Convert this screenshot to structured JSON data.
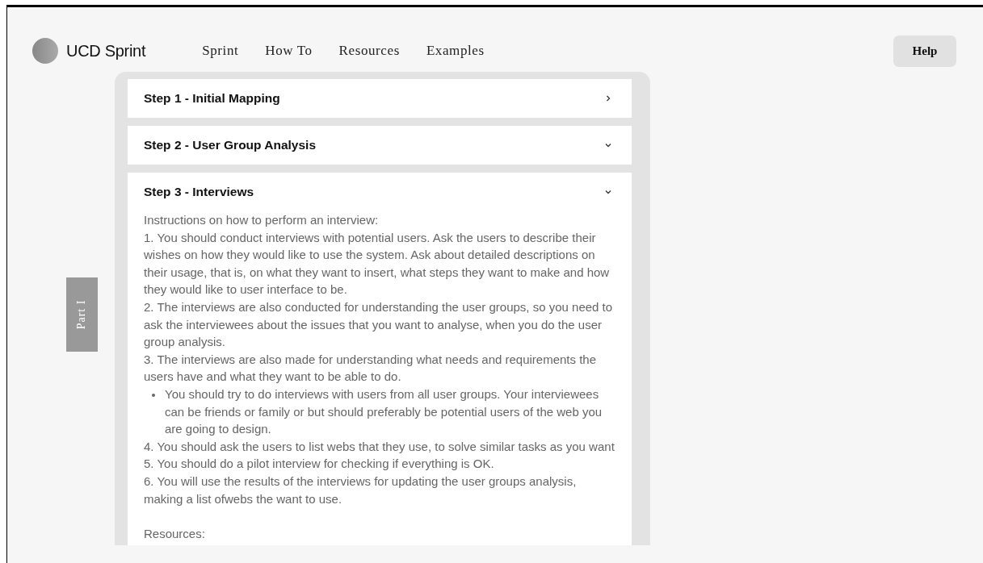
{
  "header": {
    "logo_text": "UCD Sprint",
    "nav": [
      "Sprint",
      "How To",
      "Resources",
      "Examples"
    ],
    "help_button": "Help"
  },
  "side_tab": "Part I",
  "steps": [
    {
      "title": "Step 1 - Initial Mapping",
      "expanded": false
    },
    {
      "title": "Step 2 - User Group Analysis",
      "expanded": true
    },
    {
      "title": "Step 3 - Interviews",
      "expanded": true,
      "content": [
        {
          "kind": "line",
          "text": "Instructions on how to perform an interview:"
        },
        {
          "kind": "line",
          "text": "1. You should conduct interviews with potential users. Ask the users to describe their wishes on how they would like to use the system. Ask about detailed descriptions on their usage, that is, on what they want to insert, what steps they want to make and how they would like to user interface to be."
        },
        {
          "kind": "line",
          "text": "2. The interviews are also conducted for understanding the user groups, so you need to ask the interviewees about the issues that you want to analyse, when you do the user group analysis."
        },
        {
          "kind": "line",
          "text": "3. The interviews are also made for understanding what needs and requirements the users have and what they want to be able to do."
        },
        {
          "kind": "bullet",
          "text": "You should try to do interviews with users from all user groups. Your interviewees can be friends or family or but should preferably be potential users of the web you are going to design."
        },
        {
          "kind": "line",
          "text": "4. You should ask the users to list webs that they use, to solve similar tasks as you want"
        },
        {
          "kind": "line",
          "text": "5. You should do a pilot interview for checking if everything is OK."
        },
        {
          "kind": "line",
          "text": "6. You will use the results of the interviews for updating the user groups analysis, making a list ofwebs the want to use."
        },
        {
          "kind": "section",
          "text": "Resources:"
        }
      ]
    }
  ]
}
